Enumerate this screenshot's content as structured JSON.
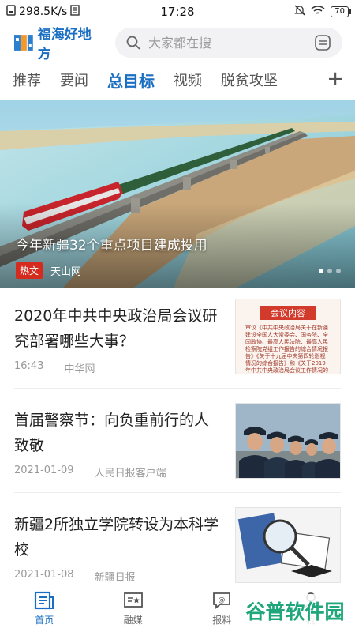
{
  "status": {
    "speed": "298.5K/s",
    "time": "17:28",
    "battery": "70"
  },
  "header": {
    "app_name": "福海好地方",
    "search_placeholder": "大家都在搜"
  },
  "tabs": [
    "推荐",
    "要闻",
    "总目标",
    "视频",
    "脱贫攻坚"
  ],
  "active_tab": "总目标",
  "banner": {
    "title": "今年新疆32个重点项目建成投用",
    "tag": "热文",
    "source": "天山网"
  },
  "news": [
    {
      "title": "2020年中共中央政治局会议研究部署哪些大事？",
      "time": "16:43",
      "source": "中华网",
      "thumb_heading": "会议内容",
      "thumb_text": "审议《中共中央政治局关于在新疆建设全国人大常委会、国务院、全国政协、最高人民法院、最高人民检察院党组工作报告的综合情况报告》《关于十九届中央第四轮巡视情况的综合报告》和《关于2019年中共中央政治局会议工作情况的报告》"
    },
    {
      "title": "首届警察节：向负重前行的人致敬",
      "time": "2021-01-09",
      "source": "人民日报客户端"
    },
    {
      "title": "新疆2所独立学院转设为本科学校",
      "time": "2021-01-08",
      "source": "新疆日报"
    }
  ],
  "bottom_nav": [
    "首页",
    "融媒",
    "报料",
    "我"
  ],
  "watermark": "谷普软件园",
  "colors": {
    "brand": "#1a6fc2",
    "hot": "#d42b1e",
    "watermark": "#1fa67a"
  }
}
